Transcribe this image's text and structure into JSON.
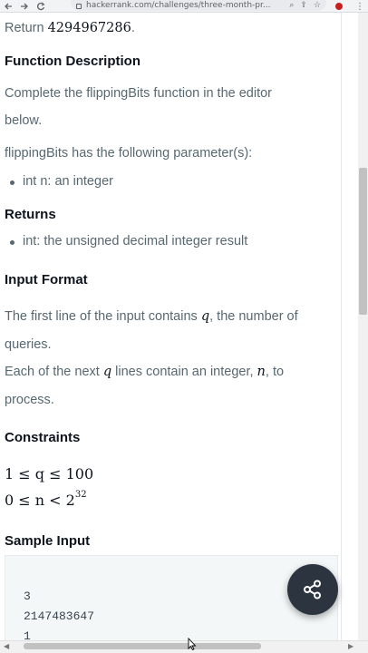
{
  "browser": {
    "url": "hackerrank.com/challenges/three-month-pr...",
    "back_icon": "arrow-left-icon",
    "forward_icon": "arrow-right-icon",
    "reload_icon": "reload-icon"
  },
  "problem": {
    "return_prefix": "Return ",
    "return_value": "4294967286",
    "return_suffix": ".",
    "function_description_heading": "Function Description",
    "description_line1": "Complete the flippingBits function in the editor",
    "description_line2": "below.",
    "parameters_intro": "flippingBits has the following parameter(s):",
    "parameters": [
      "int n: an integer"
    ],
    "returns_heading": "Returns",
    "returns_items": [
      "int: the unsigned decimal integer result"
    ],
    "input_format_heading": "Input Format",
    "input_line1_pre": "The first line of the input contains ",
    "input_line1_var": "q",
    "input_line1_post": ", the number of",
    "input_line2": "queries.",
    "input_line3_pre": "Each of the next ",
    "input_line3_var": "q",
    "input_line3_mid": " lines contain an integer, ",
    "input_line3_var2": "n",
    "input_line3_post": ", to",
    "input_line4": "process.",
    "constraints_heading": "Constraints",
    "constraint1": "1 ≤ q ≤ 100",
    "constraint2_base": "0 ≤ n < 2",
    "constraint2_exp": "32",
    "sample_input_heading": "Sample Input",
    "sample_input_lines": [
      "3",
      "2147483647",
      "1"
    ]
  },
  "share_button_icon": "share-icon"
}
